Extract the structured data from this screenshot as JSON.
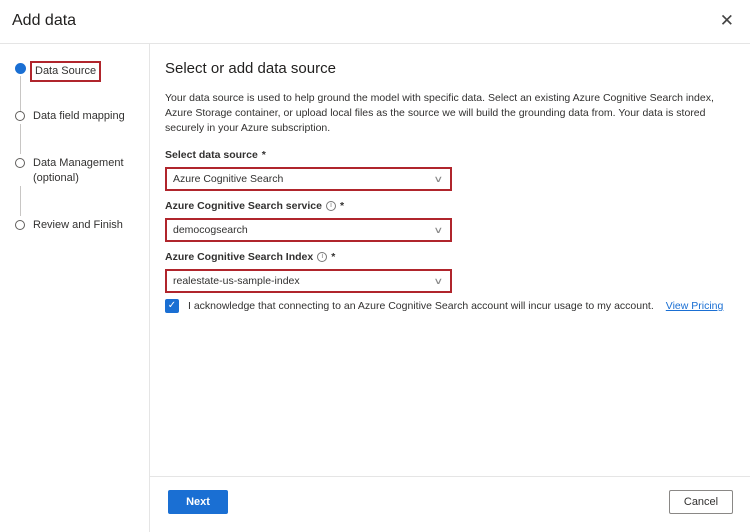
{
  "dialog": {
    "title": "Add data"
  },
  "steps": [
    {
      "label": "Data Source",
      "active": true
    },
    {
      "label": "Data field mapping"
    },
    {
      "label": "Data Management (optional)"
    },
    {
      "label": "Review and Finish"
    }
  ],
  "main": {
    "heading": "Select or add data source",
    "description": "Your data source is used to help ground the model with specific data. Select an existing Azure Cognitive Search index, Azure Storage container, or upload local files as the source we will build the grounding data from. Your data is stored securely in your Azure subscription.",
    "fields": [
      {
        "label": "Select data source",
        "required": "*",
        "value": "Azure Cognitive Search"
      },
      {
        "label": "Azure Cognitive Search service",
        "required": "*",
        "value": "democogsearch"
      },
      {
        "label": "Azure Cognitive Search Index",
        "required": "*",
        "value": "realestate-us-sample-index"
      }
    ],
    "acknowledge": {
      "text": "I acknowledge that connecting to an Azure Cognitive Search account will incur usage to my account.",
      "link": "View Pricing",
      "checked": true
    }
  },
  "footer": {
    "next": "Next",
    "cancel": "Cancel"
  },
  "colors": {
    "accent": "#1a6fd3",
    "highlight": "#b0252c"
  }
}
